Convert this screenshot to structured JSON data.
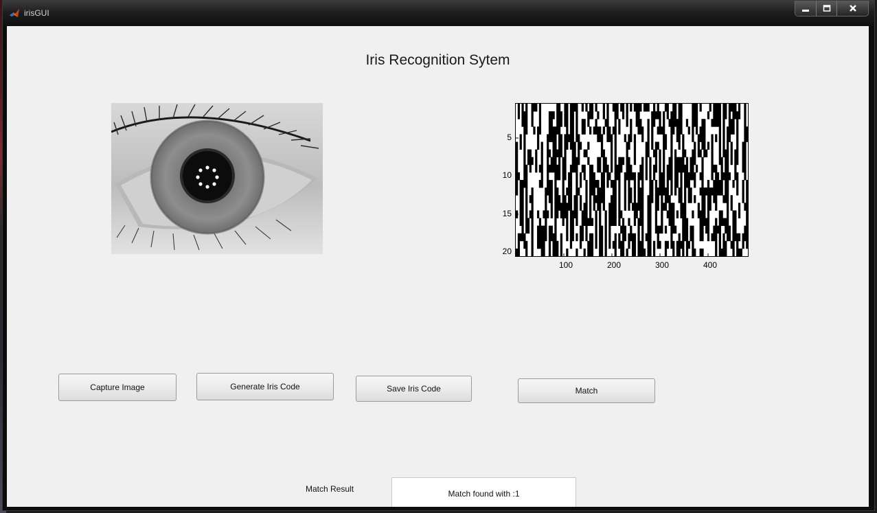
{
  "window": {
    "title": "irisGUI",
    "controls": [
      "minimize",
      "maximize",
      "close"
    ],
    "title_icon": "matlab-icon"
  },
  "main": {
    "heading": "Iris Recognition Sytem",
    "eye_image": {
      "description_icon": "eye-photo"
    },
    "iris_code_plot": {
      "y_ticks": [
        "5",
        "10",
        "15",
        "20"
      ],
      "x_ticks": [
        "100",
        "200",
        "300",
        "400"
      ],
      "colormap": [
        "#000000",
        "#ffffff"
      ]
    }
  },
  "buttons": {
    "capture": "Capture Image",
    "generate": "Generate Iris Code",
    "save": "Save Iris Code",
    "match": "Match"
  },
  "result": {
    "label": "Match Result",
    "value": "Match found with :1"
  }
}
